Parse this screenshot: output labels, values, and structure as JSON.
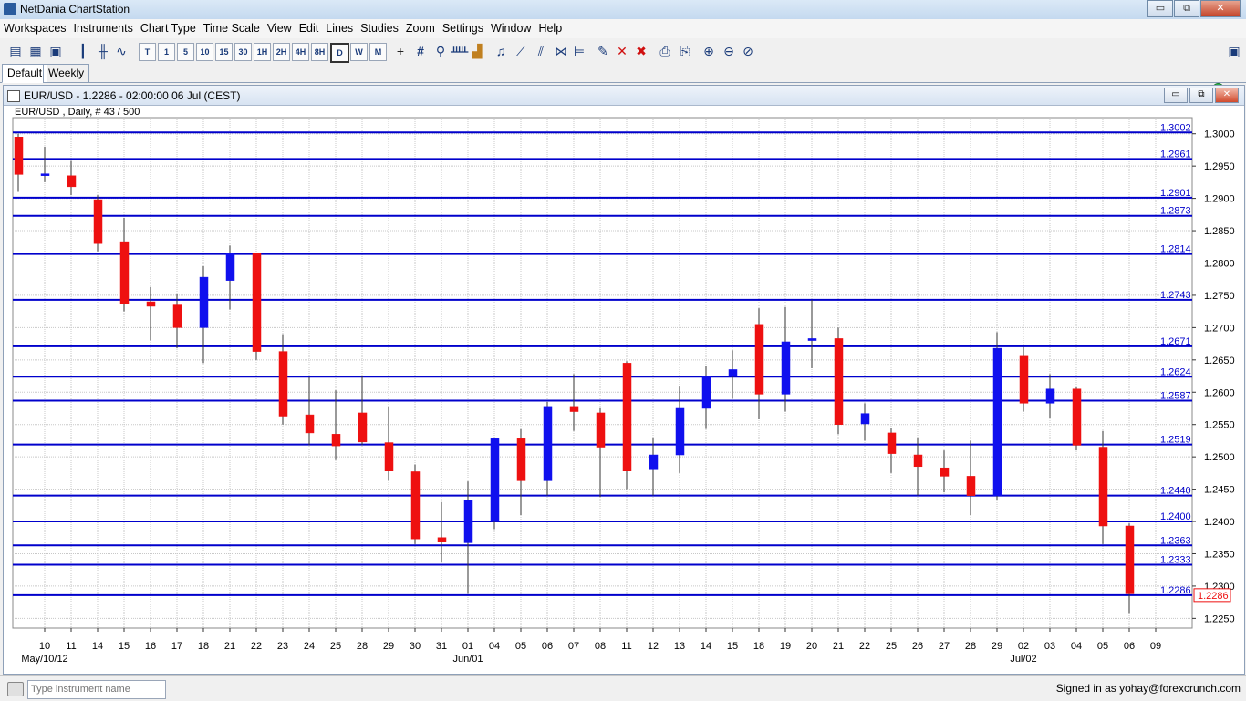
{
  "window": {
    "title": "NetDania ChartStation",
    "controls": [
      "▭",
      "⧉",
      "✕"
    ]
  },
  "menu": [
    "Workspaces",
    "Instruments",
    "Chart Type",
    "Time Scale",
    "View",
    "Edit",
    "Lines",
    "Studies",
    "Zoom",
    "Settings",
    "Window",
    "Help"
  ],
  "toolbar": {
    "timeframes": [
      "T",
      "1",
      "5",
      "10",
      "15",
      "30",
      "1H",
      "2H",
      "4H",
      "8H",
      "D",
      "W",
      "M"
    ],
    "selected_timeframe": "D"
  },
  "tabs": [
    {
      "label": "Default",
      "active": true
    },
    {
      "label": "Weekly",
      "active": false
    }
  ],
  "chart_window": {
    "title": "EUR/USD - 1.2286 - 02:00:00  06 Jul (CEST)"
  },
  "status": {
    "search_placeholder": "Type instrument name",
    "signed_in": "Signed in as yohay@forexcrunch.com"
  },
  "colors": {
    "up": "#1010ee",
    "down": "#ee1010",
    "hline": "#0000cc",
    "grid": "#c8c8c8"
  },
  "chart_data": {
    "type": "candlestick",
    "header": "EUR/USD , Daily, # 43 / 500",
    "x_tick_labels": [
      "10",
      "11",
      "14",
      "15",
      "16",
      "17",
      "18",
      "21",
      "22",
      "23",
      "24",
      "25",
      "28",
      "29",
      "30",
      "31",
      "01",
      "04",
      "05",
      "06",
      "07",
      "08",
      "11",
      "12",
      "13",
      "14",
      "15",
      "18",
      "19",
      "20",
      "21",
      "22",
      "25",
      "26",
      "27",
      "28",
      "29",
      "02",
      "03",
      "04",
      "05",
      "06",
      "09"
    ],
    "period_labels": [
      {
        "label": "May/10/12",
        "under": "10"
      },
      {
        "label": "Jun/01",
        "under": "01"
      },
      {
        "label": "Jul/02",
        "under": "02"
      }
    ],
    "ylim": [
      1.2235,
      1.3025
    ],
    "y_ticks": [
      "1.3000",
      "1.2950",
      "1.2900",
      "1.2850",
      "1.2800",
      "1.2750",
      "1.2700",
      "1.2650",
      "1.2600",
      "1.2550",
      "1.2500",
      "1.2450",
      "1.2400",
      "1.2350",
      "1.2300",
      "1.2250"
    ],
    "horizontal_lines": [
      "1.3002",
      "1.2961",
      "1.2901",
      "1.2873",
      "1.2814",
      "1.2743",
      "1.2671",
      "1.2624",
      "1.2587",
      "1.2519",
      "1.2440",
      "1.2400",
      "1.2363",
      "1.2333",
      "1.2286"
    ],
    "last_price": "1.2286",
    "candles": [
      {
        "o": 1.2995,
        "h": 1.3,
        "l": 1.291,
        "c": 1.2937
      },
      {
        "o": 1.2937,
        "h": 1.298,
        "l": 1.2925,
        "c": 1.2938
      },
      {
        "o": 1.2935,
        "h": 1.2958,
        "l": 1.2905,
        "c": 1.2918
      },
      {
        "o": 1.2898,
        "h": 1.2905,
        "l": 1.2818,
        "c": 1.283
      },
      {
        "o": 1.2833,
        "h": 1.287,
        "l": 1.2725,
        "c": 1.2737
      },
      {
        "o": 1.274,
        "h": 1.2763,
        "l": 1.268,
        "c": 1.2733
      },
      {
        "o": 1.2735,
        "h": 1.2752,
        "l": 1.2668,
        "c": 1.27
      },
      {
        "o": 1.27,
        "h": 1.2795,
        "l": 1.2645,
        "c": 1.2778
      },
      {
        "o": 1.2773,
        "h": 1.2827,
        "l": 1.2728,
        "c": 1.2815
      },
      {
        "o": 1.2815,
        "h": 1.2815,
        "l": 1.265,
        "c": 1.2663
      },
      {
        "o": 1.2663,
        "h": 1.269,
        "l": 1.255,
        "c": 1.2563
      },
      {
        "o": 1.2565,
        "h": 1.2623,
        "l": 1.2518,
        "c": 1.2537
      },
      {
        "o": 1.2535,
        "h": 1.2603,
        "l": 1.2495,
        "c": 1.2517
      },
      {
        "o": 1.2568,
        "h": 1.2625,
        "l": 1.2518,
        "c": 1.2523
      },
      {
        "o": 1.2522,
        "h": 1.2578,
        "l": 1.2463,
        "c": 1.2478
      },
      {
        "o": 1.2477,
        "h": 1.2488,
        "l": 1.2365,
        "c": 1.2373
      },
      {
        "o": 1.2375,
        "h": 1.243,
        "l": 1.2338,
        "c": 1.2368
      },
      {
        "o": 1.2367,
        "h": 1.2462,
        "l": 1.2288,
        "c": 1.2433
      },
      {
        "o": 1.24,
        "h": 1.253,
        "l": 1.2388,
        "c": 1.2528
      },
      {
        "o": 1.2528,
        "h": 1.2543,
        "l": 1.241,
        "c": 1.2463
      },
      {
        "o": 1.2463,
        "h": 1.2585,
        "l": 1.244,
        "c": 1.2578
      },
      {
        "o": 1.2578,
        "h": 1.2628,
        "l": 1.254,
        "c": 1.257
      },
      {
        "o": 1.2568,
        "h": 1.2575,
        "l": 1.2438,
        "c": 1.2515
      },
      {
        "o": 1.2645,
        "h": 1.2648,
        "l": 1.245,
        "c": 1.2478
      },
      {
        "o": 1.248,
        "h": 1.253,
        "l": 1.244,
        "c": 1.2503
      },
      {
        "o": 1.2503,
        "h": 1.261,
        "l": 1.2475,
        "c": 1.2575
      },
      {
        "o": 1.2575,
        "h": 1.264,
        "l": 1.2543,
        "c": 1.2625
      },
      {
        "o": 1.2625,
        "h": 1.2665,
        "l": 1.259,
        "c": 1.2635
      },
      {
        "o": 1.2705,
        "h": 1.273,
        "l": 1.2558,
        "c": 1.2597
      },
      {
        "o": 1.2597,
        "h": 1.2732,
        "l": 1.257,
        "c": 1.2678
      },
      {
        "o": 1.268,
        "h": 1.2743,
        "l": 1.2637,
        "c": 1.2683
      },
      {
        "o": 1.2683,
        "h": 1.27,
        "l": 1.2535,
        "c": 1.255
      },
      {
        "o": 1.2551,
        "h": 1.2583,
        "l": 1.2525,
        "c": 1.2567
      },
      {
        "o": 1.2537,
        "h": 1.2545,
        "l": 1.2475,
        "c": 1.2505
      },
      {
        "o": 1.2503,
        "h": 1.253,
        "l": 1.244,
        "c": 1.2485
      },
      {
        "o": 1.2483,
        "h": 1.251,
        "l": 1.2445,
        "c": 1.247
      },
      {
        "o": 1.247,
        "h": 1.2525,
        "l": 1.241,
        "c": 1.244
      },
      {
        "o": 1.244,
        "h": 1.2693,
        "l": 1.2433,
        "c": 1.2668
      },
      {
        "o": 1.2657,
        "h": 1.267,
        "l": 1.257,
        "c": 1.2583
      },
      {
        "o": 1.2583,
        "h": 1.2628,
        "l": 1.256,
        "c": 1.2605
      },
      {
        "o": 1.2605,
        "h": 1.2608,
        "l": 1.251,
        "c": 1.2518
      },
      {
        "o": 1.2515,
        "h": 1.254,
        "l": 1.2365,
        "c": 1.2393
      },
      {
        "o": 1.2393,
        "h": 1.2397,
        "l": 1.2257,
        "c": 1.2288
      }
    ]
  }
}
